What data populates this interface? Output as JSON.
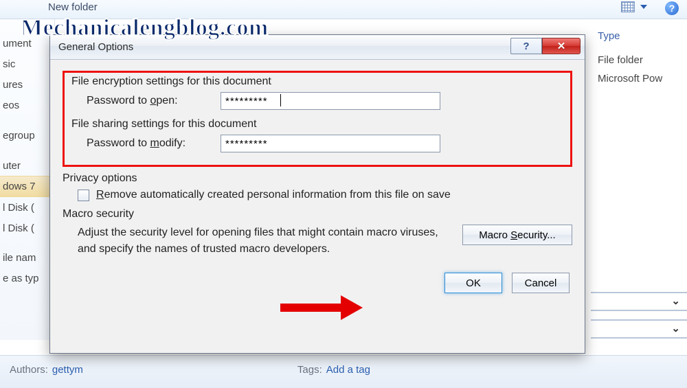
{
  "watermark": "Mechanicalengblog.com",
  "topbar": {
    "new_folder": "New folder"
  },
  "left_items": [
    "ument",
    "sic",
    "ures",
    "eos",
    "egroup",
    "uter",
    "dows 7",
    "l Disk (",
    "l Disk (",
    "ile nam",
    "e as typ"
  ],
  "right": {
    "type_header": "Type",
    "row1": "File folder",
    "row2": "Microsoft Pow"
  },
  "bottom": {
    "authors_label": "Authors:",
    "authors_val": "gettym",
    "tags_label": "Tags:",
    "tags_val": "Add a tag"
  },
  "dialog": {
    "title": "General Options",
    "enc_header": "File encryption settings for this document",
    "open_label_pre": "Password to ",
    "open_label_u": "o",
    "open_label_post": "pen:",
    "open_value": "*********",
    "share_header": "File sharing settings for this document",
    "mod_label_pre": "Password to ",
    "mod_label_u": "m",
    "mod_label_post": "odify:",
    "mod_value": "*********",
    "privacy_header": "Privacy options",
    "remove_u": "R",
    "remove_post": "emove automatically created personal information from this file on save",
    "macro_header": "Macro security",
    "macro_text": "Adjust the security level for opening files that might contain macro viruses, and specify the names of trusted macro developers.",
    "macro_btn_pre": "Macro ",
    "macro_btn_u": "S",
    "macro_btn_post": "ecurity...",
    "ok": "OK",
    "cancel": "Cancel"
  }
}
